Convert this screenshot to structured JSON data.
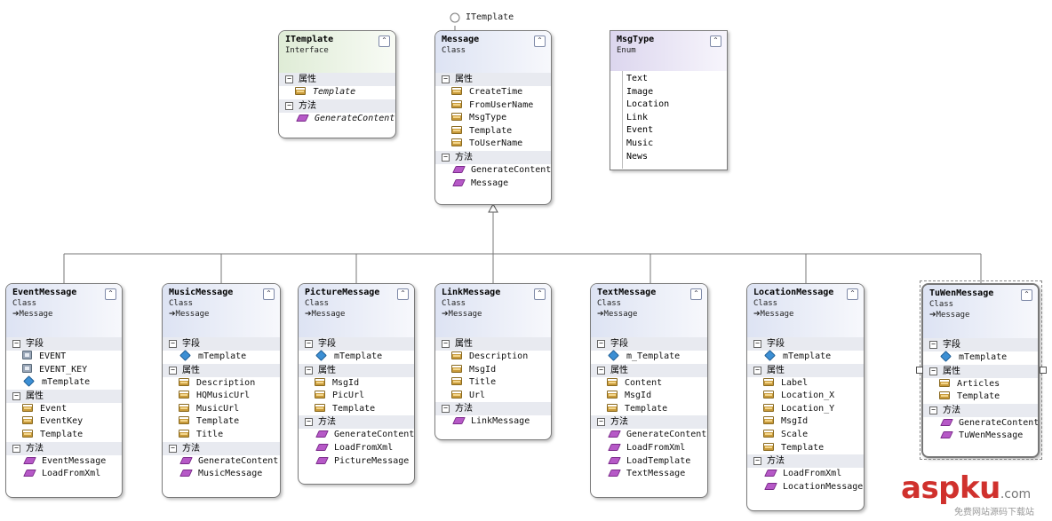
{
  "lollipop": {
    "label": "ITemplate"
  },
  "interface": {
    "name": "ITemplate",
    "kind": "Interface",
    "sections": [
      {
        "label": "属性",
        "members": [
          {
            "name": "Template",
            "icon": "property-icon"
          }
        ]
      },
      {
        "label": "方法",
        "members": [
          {
            "name": "GenerateContent",
            "icon": "method-icon"
          }
        ]
      }
    ]
  },
  "message": {
    "name": "Message",
    "kind": "Class",
    "sections": [
      {
        "label": "属性",
        "members": [
          {
            "name": "CreateTime",
            "icon": "property-icon"
          },
          {
            "name": "FromUserName",
            "icon": "property-icon"
          },
          {
            "name": "MsgType",
            "icon": "property-icon"
          },
          {
            "name": "Template",
            "icon": "property-icon"
          },
          {
            "name": "ToUserName",
            "icon": "property-icon"
          }
        ]
      },
      {
        "label": "方法",
        "members": [
          {
            "name": "GenerateContent",
            "icon": "method-icon"
          },
          {
            "name": "Message",
            "icon": "method-icon"
          }
        ]
      }
    ]
  },
  "msgtype": {
    "name": "MsgType",
    "kind": "Enum",
    "items": [
      "Text",
      "Image",
      "Location",
      "Link",
      "Event",
      "Music",
      "News"
    ]
  },
  "subclasses": [
    {
      "id": "event",
      "name": "EventMessage",
      "kind": "Class",
      "base": "Message",
      "sections": [
        {
          "label": "字段",
          "members": [
            {
              "name": "EVENT",
              "icon": "const-field-icon"
            },
            {
              "name": "EVENT_KEY",
              "icon": "const-field-icon"
            },
            {
              "name": "mTemplate",
              "icon": "field-icon"
            }
          ]
        },
        {
          "label": "属性",
          "members": [
            {
              "name": "Event",
              "icon": "property-icon"
            },
            {
              "name": "EventKey",
              "icon": "property-icon"
            },
            {
              "name": "Template",
              "icon": "property-icon"
            }
          ]
        },
        {
          "label": "方法",
          "members": [
            {
              "name": "EventMessage",
              "icon": "method-icon"
            },
            {
              "name": "LoadFromXml",
              "icon": "method-icon"
            }
          ]
        }
      ]
    },
    {
      "id": "music",
      "name": "MusicMessage",
      "kind": "Class",
      "base": "Message",
      "sections": [
        {
          "label": "字段",
          "members": [
            {
              "name": "mTemplate",
              "icon": "field-icon"
            }
          ]
        },
        {
          "label": "属性",
          "members": [
            {
              "name": "Description",
              "icon": "property-icon"
            },
            {
              "name": "HQMusicUrl",
              "icon": "property-icon"
            },
            {
              "name": "MusicUrl",
              "icon": "property-icon"
            },
            {
              "name": "Template",
              "icon": "property-icon"
            },
            {
              "name": "Title",
              "icon": "property-icon"
            }
          ]
        },
        {
          "label": "方法",
          "members": [
            {
              "name": "GenerateContent",
              "icon": "method-icon"
            },
            {
              "name": "MusicMessage",
              "icon": "method-icon"
            }
          ]
        }
      ]
    },
    {
      "id": "picture",
      "name": "PictureMessage",
      "kind": "Class",
      "base": "Message",
      "sections": [
        {
          "label": "字段",
          "members": [
            {
              "name": "mTemplate",
              "icon": "field-icon"
            }
          ]
        },
        {
          "label": "属性",
          "members": [
            {
              "name": "MsgId",
              "icon": "property-icon"
            },
            {
              "name": "PicUrl",
              "icon": "property-icon"
            },
            {
              "name": "Template",
              "icon": "property-icon"
            }
          ]
        },
        {
          "label": "方法",
          "members": [
            {
              "name": "GenerateContent",
              "icon": "method-icon"
            },
            {
              "name": "LoadFromXml",
              "icon": "method-icon"
            },
            {
              "name": "PictureMessage",
              "icon": "method-icon"
            }
          ]
        }
      ]
    },
    {
      "id": "link",
      "name": "LinkMessage",
      "kind": "Class",
      "base": "Message",
      "sections": [
        {
          "label": "属性",
          "members": [
            {
              "name": "Description",
              "icon": "property-icon"
            },
            {
              "name": "MsgId",
              "icon": "property-icon"
            },
            {
              "name": "Title",
              "icon": "property-icon"
            },
            {
              "name": "Url",
              "icon": "property-icon"
            }
          ]
        },
        {
          "label": "方法",
          "members": [
            {
              "name": "LinkMessage",
              "icon": "method-icon"
            }
          ]
        }
      ]
    },
    {
      "id": "text",
      "name": "TextMessage",
      "kind": "Class",
      "base": "Message",
      "sections": [
        {
          "label": "字段",
          "members": [
            {
              "name": "m_Template",
              "icon": "field-icon"
            }
          ]
        },
        {
          "label": "属性",
          "members": [
            {
              "name": "Content",
              "icon": "property-icon"
            },
            {
              "name": "MsgId",
              "icon": "property-icon"
            },
            {
              "name": "Template",
              "icon": "property-icon"
            }
          ]
        },
        {
          "label": "方法",
          "members": [
            {
              "name": "GenerateContent",
              "icon": "method-icon"
            },
            {
              "name": "LoadFromXml",
              "icon": "method-icon"
            },
            {
              "name": "LoadTemplate",
              "icon": "method-icon"
            },
            {
              "name": "TextMessage",
              "icon": "method-icon"
            }
          ]
        }
      ]
    },
    {
      "id": "location",
      "name": "LocationMessage",
      "kind": "Class",
      "base": "Message",
      "sections": [
        {
          "label": "字段",
          "members": [
            {
              "name": "mTemplate",
              "icon": "field-icon"
            }
          ]
        },
        {
          "label": "属性",
          "members": [
            {
              "name": "Label",
              "icon": "property-icon"
            },
            {
              "name": "Location_X",
              "icon": "property-icon"
            },
            {
              "name": "Location_Y",
              "icon": "property-icon"
            },
            {
              "name": "MsgId",
              "icon": "property-icon"
            },
            {
              "name": "Scale",
              "icon": "property-icon"
            },
            {
              "name": "Template",
              "icon": "property-icon"
            }
          ]
        },
        {
          "label": "方法",
          "members": [
            {
              "name": "LoadFromXml",
              "icon": "method-icon"
            },
            {
              "name": "LocationMessage",
              "icon": "method-icon"
            }
          ]
        }
      ]
    },
    {
      "id": "tuwen",
      "name": "TuWenMessage",
      "kind": "Class",
      "base": "Message",
      "sections": [
        {
          "label": "字段",
          "members": [
            {
              "name": "mTemplate",
              "icon": "field-icon"
            }
          ]
        },
        {
          "label": "属性",
          "members": [
            {
              "name": "Articles",
              "icon": "property-icon"
            },
            {
              "name": "Template",
              "icon": "property-icon"
            }
          ]
        },
        {
          "label": "方法",
          "members": [
            {
              "name": "GenerateContent",
              "icon": "method-icon"
            },
            {
              "name": "TuWenMessage",
              "icon": "method-icon"
            }
          ]
        }
      ]
    }
  ],
  "watermark": {
    "main": "aspku",
    "suffix": ".com",
    "sub": "免费网站源码下载站"
  },
  "ui": {
    "collapse_glyph": "⌃",
    "base_arrow": "➔",
    "section_toggle": "−"
  },
  "colors": {
    "class_header": "#dde3f3",
    "interface_header": "#dfecd6",
    "enum_header": "#dcd6ee",
    "method_icon": "#b659c7",
    "property_icon": "#c89a3a",
    "field_icon": "#3c8fd4",
    "watermark": "#d0312d"
  }
}
